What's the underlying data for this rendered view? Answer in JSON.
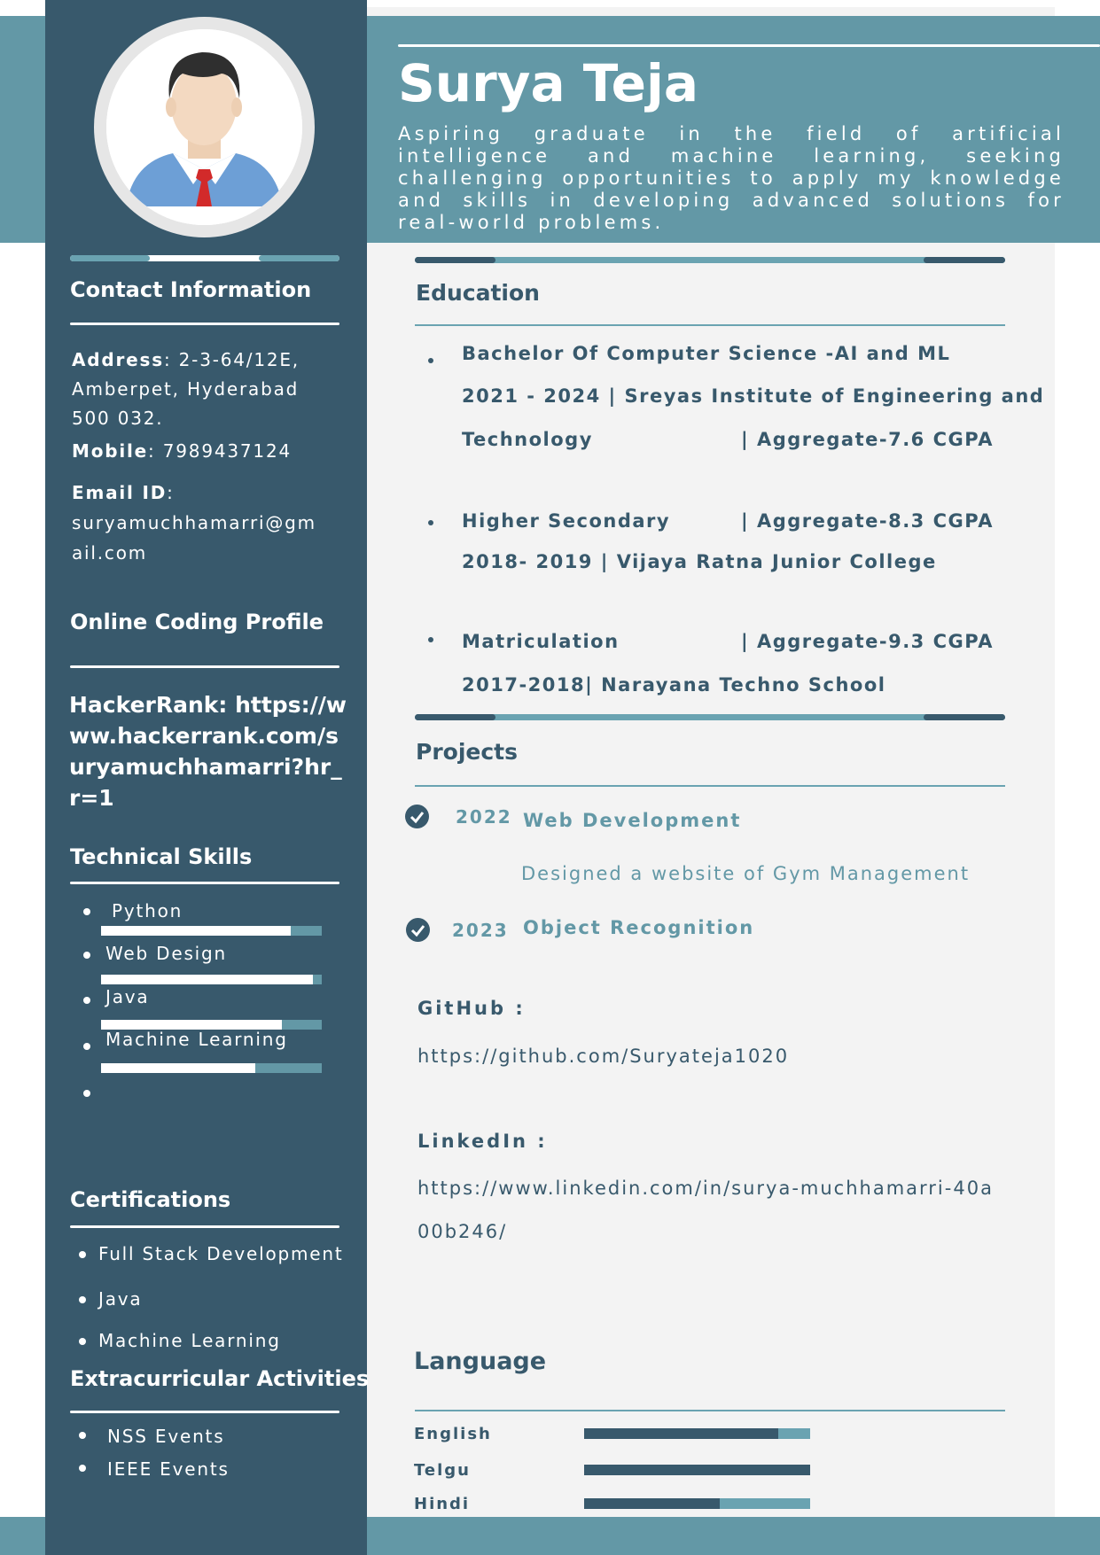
{
  "header": {
    "name": "Surya Teja",
    "summary": "Aspiring graduate in the field of artificial intelligence and machine learning, seeking challenging opportunities to apply my knowledge and skills in developing advanced solutions for real-world problems."
  },
  "contact": {
    "heading": "Contact Information",
    "address_label": "Address",
    "address_line1": ": 2-3-64/12E,",
    "address_line2": "Amberpet, Hyderabad",
    "address_line3": "500 032.",
    "mobile_label": "Mobile",
    "mobile_value": ": 7989437124",
    "email_label": "Email ID",
    "email_colon": ":",
    "email_line1": "suryamuchhamarri@gm",
    "email_line2": "ail.com"
  },
  "coding_profile": {
    "heading": "Online Coding Profile",
    "text": "HackerRank: https://www.hackerrank.com/suryamuchhamarri?hr_r=1"
  },
  "skills": {
    "heading": "Technical Skills",
    "items": [
      {
        "label": "Python",
        "level": 0.86
      },
      {
        "label": "Web Design",
        "level": 0.96
      },
      {
        "label": "Java",
        "level": 0.82
      },
      {
        "label": "Machine Learning",
        "level": 0.7
      }
    ]
  },
  "certifications": {
    "heading": "Certifications",
    "items": [
      "Full Stack Development",
      "Java",
      "Machine Learning"
    ]
  },
  "extracurricular": {
    "heading": "Extracurricular Activities",
    "items": [
      "NSS Events",
      "IEEE Events"
    ]
  },
  "education": {
    "heading": "Education",
    "entries": [
      {
        "line1": "Bachelor Of Computer Science -AI and ML",
        "line2": "2021 - 2024 | Sreyas Institute of Engineering and",
        "line3": "Technology",
        "aggregate": "| Aggregate-7.6 CGPA"
      },
      {
        "line1": "Higher Secondary",
        "aggregate": "| Aggregate-8.3 CGPA",
        "line2": "2018- 2019 | Vijaya Ratna Junior College"
      },
      {
        "line1": "Matriculation",
        "aggregate": "| Aggregate-9.3 CGPA",
        "line2": "2017-2018| Narayana Techno School"
      }
    ]
  },
  "projects": {
    "heading": "Projects",
    "items": [
      {
        "year": "2022",
        "title": "Web Development",
        "description": "Designed a website of Gym Management"
      },
      {
        "year": "2023",
        "title": "Object Recognition"
      }
    ]
  },
  "links": {
    "github_label": "GitHub :",
    "github_url": "https://github.com/Suryateja1020",
    "linkedin_label": "LinkedIn :",
    "linkedin_url": "https://www.linkedin.com/in/surya-muchhamarri-40a00b246/"
  },
  "languages": {
    "heading": "Language",
    "items": [
      {
        "name": "English",
        "level": 0.86
      },
      {
        "name": "Telgu",
        "level": 1.0
      },
      {
        "name": "Hindi",
        "level": 0.6
      }
    ]
  },
  "colors": {
    "sidebar": "#38596c",
    "accent": "#6398a6",
    "main_bg": "#f3f3f3"
  }
}
